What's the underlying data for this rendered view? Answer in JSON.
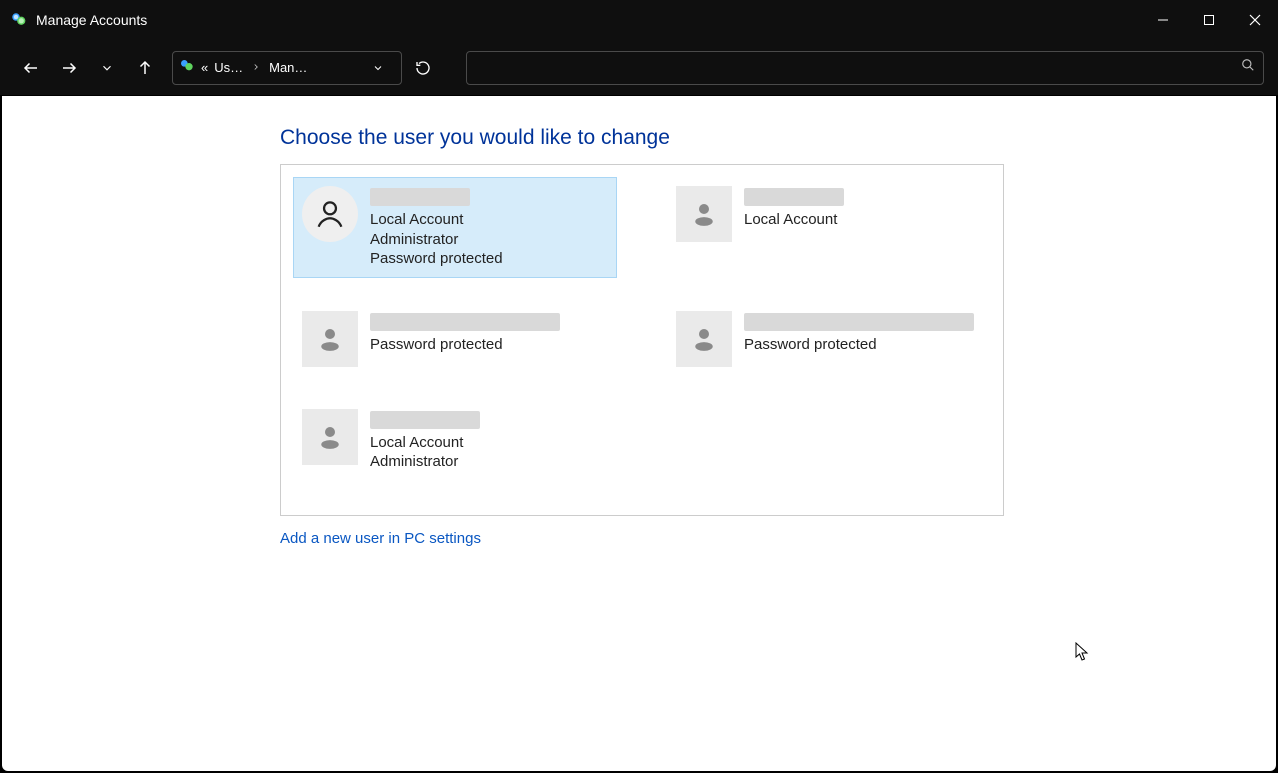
{
  "window": {
    "title": "Manage Accounts"
  },
  "breadcrumb": {
    "prefix": "«",
    "first": "Us…",
    "second": "Man…"
  },
  "heading": "Choose the user you would like to change",
  "add_link": "Add a new user in PC settings",
  "accounts": [
    {
      "type": "Local Account",
      "role": "Administrator",
      "pw": "Password protected"
    },
    {
      "type": "Local Account"
    },
    {
      "pw": "Password protected"
    },
    {
      "pw": "Password protected"
    },
    {
      "type": "Local Account",
      "role": "Administrator"
    }
  ]
}
